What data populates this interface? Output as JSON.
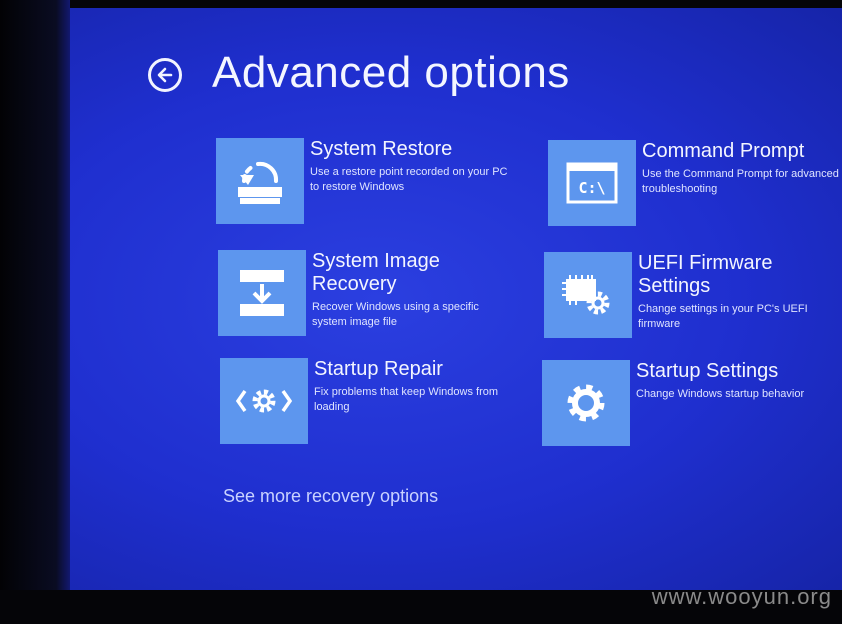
{
  "page": {
    "title": "Advanced options"
  },
  "options": [
    {
      "title": "System Restore",
      "description": "Use a restore point recorded on your PC to restore Windows",
      "icon": "system-restore-icon"
    },
    {
      "title": "Command Prompt",
      "description": "Use the Command Prompt for advanced troubleshooting",
      "icon": "command-prompt-icon",
      "icon_text": "C:\\"
    },
    {
      "title": "System Image Recovery",
      "description": "Recover Windows using a specific system image file",
      "icon": "system-image-recovery-icon"
    },
    {
      "title": "UEFI Firmware Settings",
      "description": "Change settings in your PC's UEFI firmware",
      "icon": "uefi-firmware-icon"
    },
    {
      "title": "Startup Repair",
      "description": "Fix problems that keep Windows from loading",
      "icon": "startup-repair-icon"
    },
    {
      "title": "Startup Settings",
      "description": "Change Windows startup behavior",
      "icon": "gear-icon"
    }
  ],
  "more_link": "See more recovery options",
  "watermark": "www.wooyun.org",
  "colors": {
    "background": "#1f2fcf",
    "tile": "#5d96ee",
    "text": "#f3f5ff"
  }
}
